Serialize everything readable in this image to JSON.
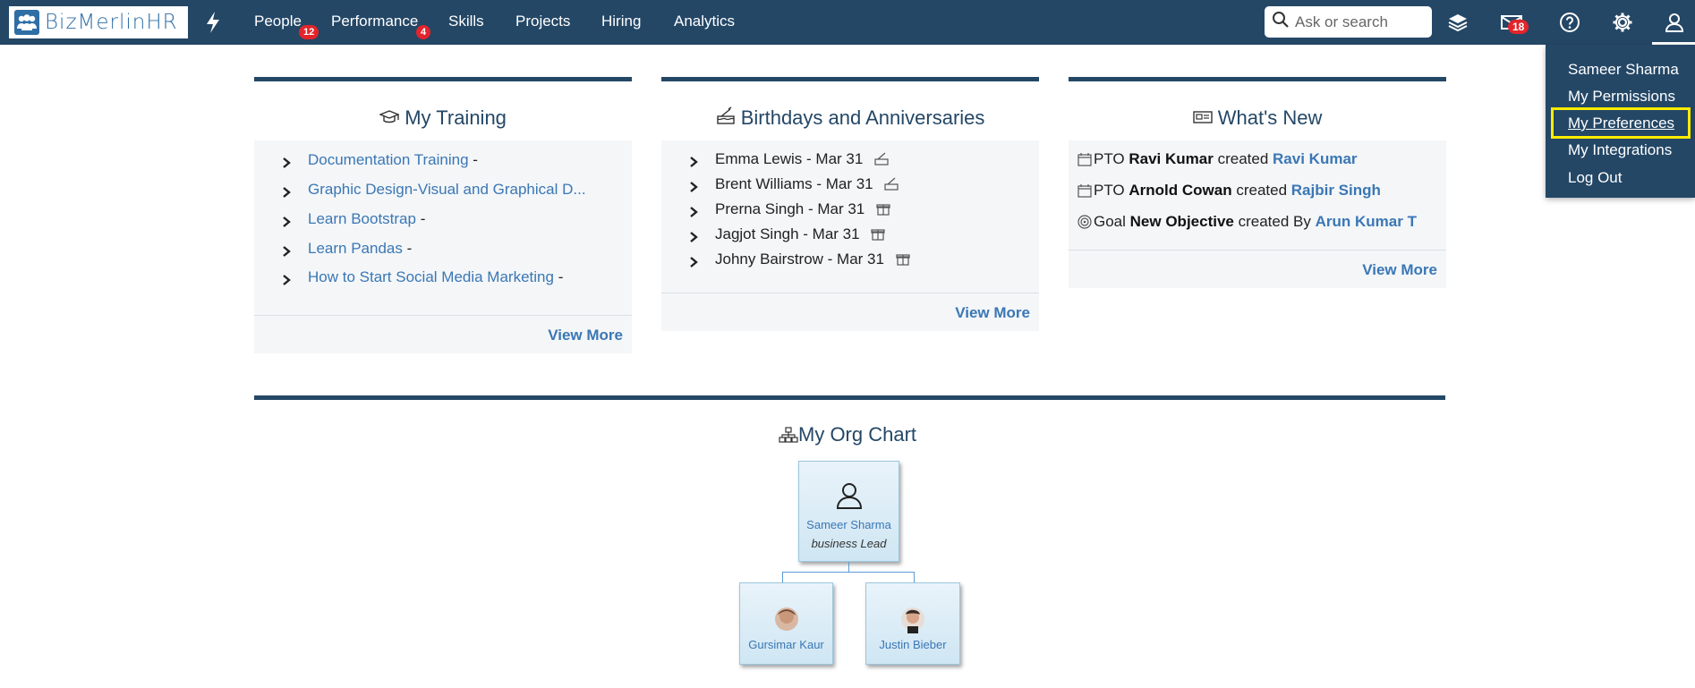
{
  "app": {
    "logo_text": "BizMerlinHR"
  },
  "nav": {
    "people": {
      "label": "People",
      "badge": "12"
    },
    "performance": {
      "label": "Performance",
      "badge": "4"
    },
    "skills": "Skills",
    "projects": "Projects",
    "hiring": "Hiring",
    "analytics": "Analytics"
  },
  "search": {
    "placeholder": "Ask or search"
  },
  "toolbar": {
    "icons": [
      "layers-icon",
      "mail-icon",
      "help-icon",
      "settings-icon",
      "user-icon"
    ],
    "mail_badge": "18"
  },
  "user_menu": {
    "items": [
      "Sameer Sharma",
      "My Permissions",
      "My Preferences",
      "My Integrations",
      "Log Out"
    ],
    "highlighted": "My Preferences"
  },
  "training": {
    "title": "My Training",
    "items": [
      {
        "name": "Documentation Training",
        "suffix": "-"
      },
      {
        "name": "Graphic Design-Visual and Graphical D...",
        "suffix": ""
      },
      {
        "name": "Learn Bootstrap",
        "suffix": "-"
      },
      {
        "name": "Learn Pandas",
        "suffix": "-"
      },
      {
        "name": "How to Start Social Media Marketing",
        "suffix": "-"
      }
    ],
    "view_more": "View More"
  },
  "birthdays": {
    "title": "Birthdays and Anniversaries",
    "items": [
      {
        "text": "Emma Lewis - Mar 31",
        "icon": "cake-icon"
      },
      {
        "text": "Brent Williams - Mar 31",
        "icon": "cake-icon"
      },
      {
        "text": "Prerna Singh - Mar 31",
        "icon": "gift-icon"
      },
      {
        "text": "Jagjot Singh - Mar 31",
        "icon": "gift-icon"
      },
      {
        "text": "Johny Bairstrow - Mar 31",
        "icon": "gift-icon"
      }
    ],
    "view_more": "View More"
  },
  "whats_new": {
    "title": "What's New",
    "items": [
      {
        "type": "PTO",
        "subject": "Ravi Kumar",
        "verb": "created",
        "actor": "Ravi Kumar",
        "icon": "calendar-icon"
      },
      {
        "type": "PTO",
        "subject": "Arnold Cowan",
        "verb": "created",
        "actor": "Rajbir Singh",
        "icon": "calendar-icon"
      },
      {
        "type": "Goal",
        "subject": "New Objective",
        "verb": "created By",
        "actor": "Arun Kumar T",
        "icon": "target-icon"
      }
    ],
    "view_more": "View More"
  },
  "org_chart": {
    "title": "My Org Chart",
    "root": {
      "name": "Sameer Sharma",
      "role": "business Lead"
    },
    "children": [
      {
        "name": "Gursimar Kaur"
      },
      {
        "name": "Justin Bieber"
      }
    ]
  },
  "colors": {
    "navy": "#244766",
    "link": "#3b77b5",
    "badge": "#e3242b",
    "highlight": "#ffed00"
  }
}
